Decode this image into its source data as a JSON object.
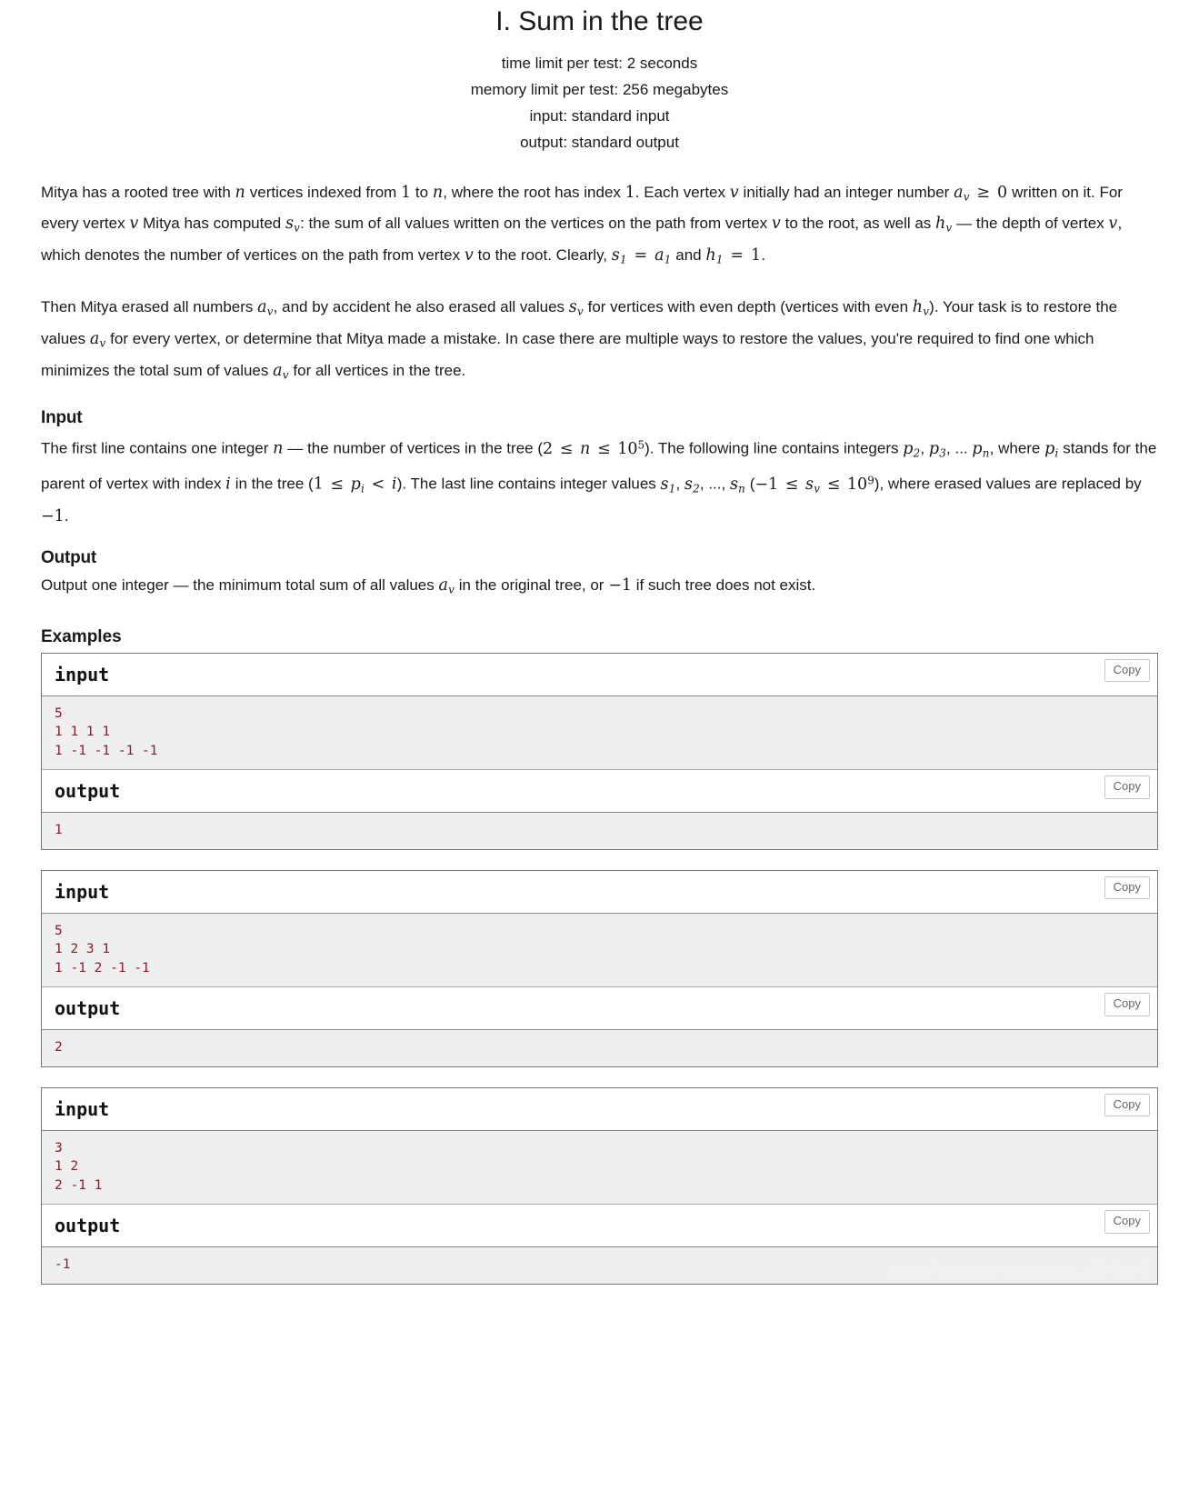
{
  "header": {
    "title": "I. Sum in the tree",
    "limits": [
      "time limit per test: 2 seconds",
      "memory limit per test: 256 megabytes",
      "input: standard input",
      "output: standard output"
    ]
  },
  "statement": {
    "paragraph1": "Mitya has a rooted tree with n vertices indexed from 1 to n, where the root has index 1. Each vertex v initially had an integer number a_v ≥ 0 written on it. For every vertex v Mitya has computed s_v: the sum of all values written on the vertices on the path from vertex v to the root, as well as h_v — the depth of vertex v, which denotes the number of vertices on the path from vertex v to the root. Clearly, s_1 = a_1 and h_1 = 1.",
    "paragraph2": "Then Mitya erased all numbers a_v, and by accident he also erased all values s_v for vertices with even depth (vertices with even h_v). Your task is to restore the values a_v for every vertex, or determine that Mitya made a mistake. In case there are multiple ways to restore the values, you're required to find one which minimizes the total sum of values a_v for all vertices in the tree."
  },
  "input_section": {
    "heading": "Input",
    "text": "The first line contains one integer n — the number of vertices in the tree (2 ≤ n ≤ 10^5). The following line contains integers p_2, p_3, ... p_n, where p_i stands for the parent of vertex with index i in the tree (1 ≤ p_i < i). The last line contains integer values s_1, s_2, ..., s_n (−1 ≤ s_v ≤ 10^9), where erased values are replaced by −1."
  },
  "output_section": {
    "heading": "Output",
    "text": "Output one integer — the minimum total sum of all values a_v in the original tree, or −1 if such tree does not exist."
  },
  "examples": {
    "heading": "Examples",
    "input_label": "input",
    "output_label": "output",
    "copy_label": "Copy",
    "tests": [
      {
        "input": "5\n1 1 1 1\n1 -1 -1 -1 -1",
        "output": "1"
      },
      {
        "input": "5\n1 2 3 1\n1 -1 2 -1 -1",
        "output": "2"
      },
      {
        "input": "3\n1 2\n2 -1 1",
        "output": "-1"
      }
    ]
  },
  "watermark": "https://blog.csdn.net/weixin_46048848"
}
